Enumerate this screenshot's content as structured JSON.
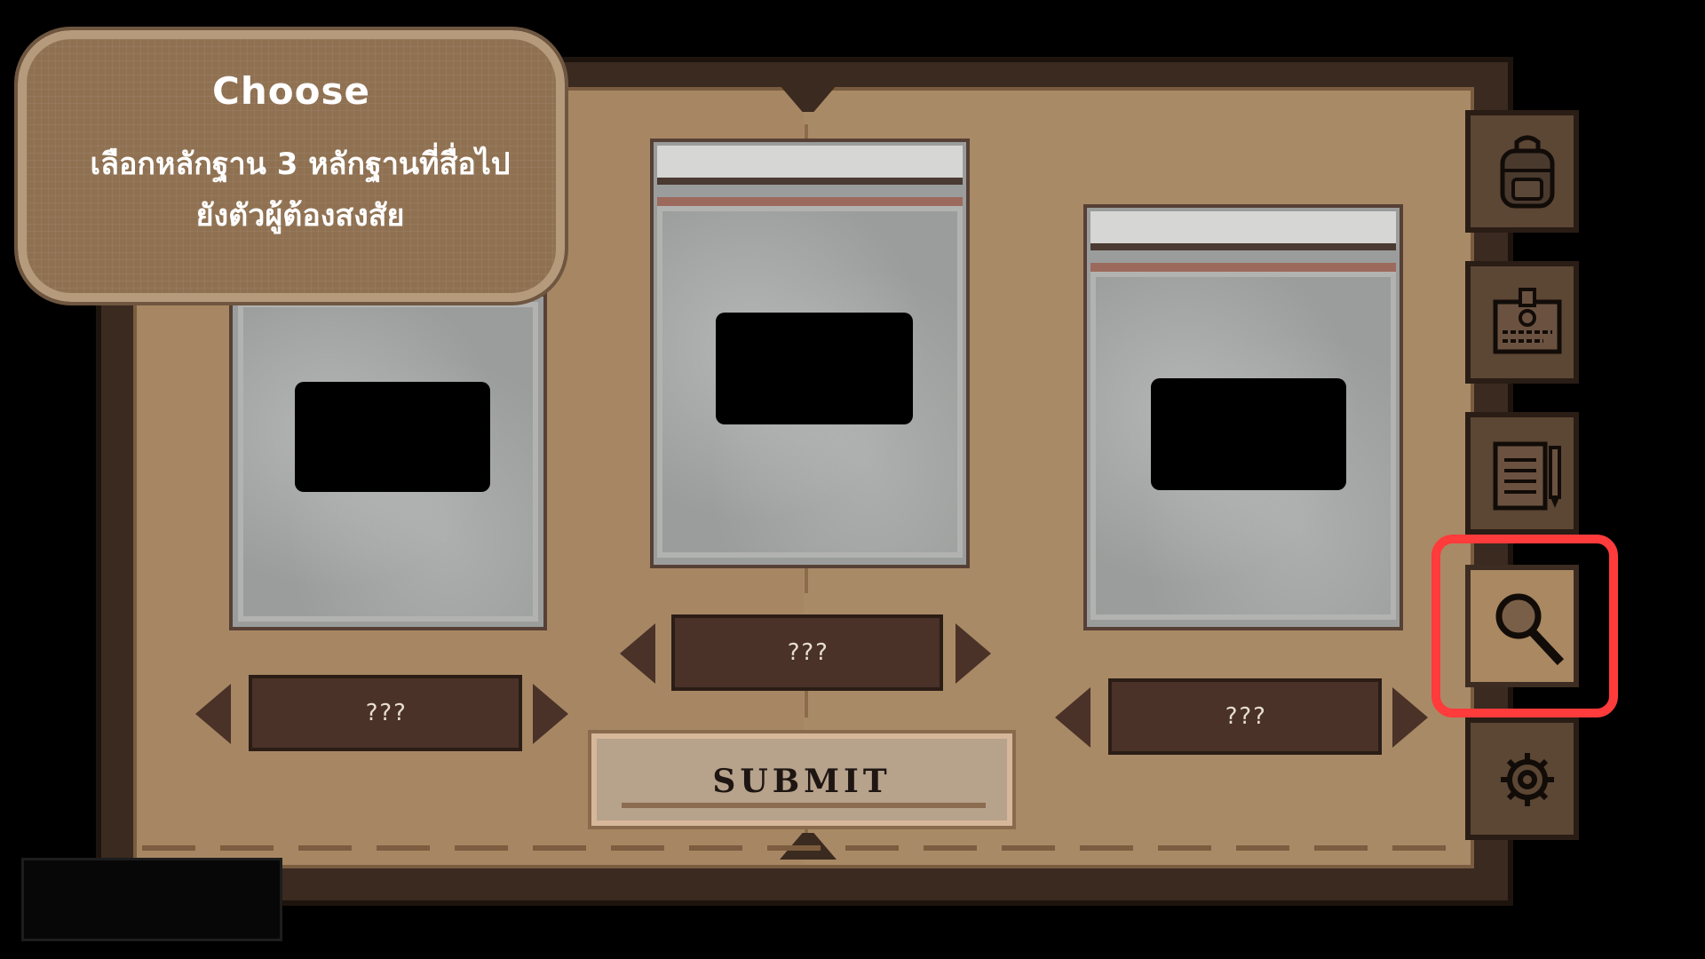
{
  "instruction_panel": {
    "title": "Choose",
    "body_line1": "เลือกหลักฐาน 3 หลักฐานที่สื่อไป",
    "body_line2": "ยังตัวผู้ต้องสงสัย"
  },
  "evidence_slots": [
    {
      "label": "???"
    },
    {
      "label": "???"
    },
    {
      "label": "???"
    }
  ],
  "submit_label": "SUBMIT",
  "sidebar": {
    "tabs": [
      {
        "icon": "backpack-icon",
        "active": false
      },
      {
        "icon": "id-card-icon",
        "active": false
      },
      {
        "icon": "notepad-icon",
        "active": false
      },
      {
        "icon": "magnifier-icon",
        "active": true
      },
      {
        "icon": "gear-icon",
        "active": false
      }
    ]
  },
  "colors": {
    "highlight": "#ff3b3b",
    "book_page": "#a98862",
    "selector": "#4a3228"
  }
}
